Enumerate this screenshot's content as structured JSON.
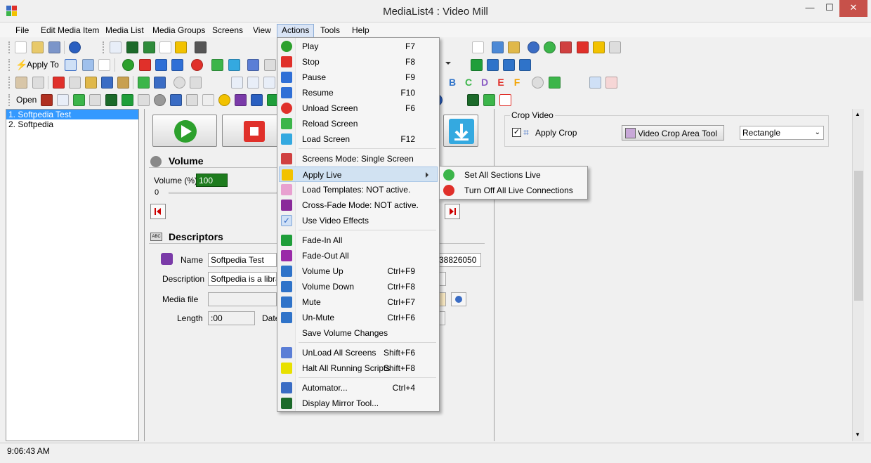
{
  "window": {
    "title": "MediaList4 : Video Mill"
  },
  "menubar": [
    "File",
    "Edit Media Item",
    "Media List",
    "Media Groups",
    "Screens",
    "View",
    "Actions",
    "Tools",
    "Help"
  ],
  "toolbar": {
    "apply_to": "Apply To",
    "open": "Open"
  },
  "media_list": [
    "1. Softpedia Test",
    "2. Softpedia"
  ],
  "volume": {
    "header": "Volume",
    "label": "Volume (%)",
    "value": "100",
    "min": "0"
  },
  "descriptors": {
    "header": "Descriptors",
    "name_label": "Name",
    "name_value": "Softpedia Test",
    "description_label": "Description",
    "description_value": "Softpedia is a library",
    "media_file_label": "Media file",
    "length_label": "Length",
    "length_value": ":00",
    "date_label": "Date",
    "id_value": "38826050"
  },
  "crop": {
    "group_title": "Crop Video",
    "apply_label": "Apply Crop",
    "tool_button": "Video Crop Area Tool",
    "shape_value": "Rectangle"
  },
  "letters": [
    "B",
    "C",
    "D",
    "E",
    "F"
  ],
  "status": {
    "time": "9:06:43 AM"
  },
  "actions_menu": {
    "items": [
      {
        "label": "Play",
        "shortcut": "F7",
        "icon": "play-icon",
        "color": "#2ca02c"
      },
      {
        "label": "Stop",
        "shortcut": "F8",
        "icon": "stop-icon",
        "color": "#e0302a"
      },
      {
        "label": "Pause",
        "shortcut": "F9",
        "icon": "pause-icon",
        "color": "#2f6fd6"
      },
      {
        "label": "Resume",
        "shortcut": "F10",
        "icon": "resume-icon",
        "color": "#2f6fd6"
      },
      {
        "label": "Unload Screen",
        "shortcut": "F6",
        "icon": "unload-screen-icon",
        "color": "#e0302a"
      },
      {
        "label": "Reload Screen",
        "shortcut": "",
        "icon": "reload-screen-icon",
        "color": "#3cb54a"
      },
      {
        "label": "Load Screen",
        "shortcut": "F12",
        "icon": "load-screen-icon",
        "color": "#34a9e0"
      },
      {
        "label": "Screens Mode: Single Screen",
        "shortcut": "",
        "icon": "screens-mode-icon",
        "color": "#d04040"
      },
      {
        "label": "Apply Live",
        "shortcut": "",
        "icon": "lightning-icon",
        "color": "#f2c200"
      },
      {
        "label": "Load Templates: NOT active.",
        "shortcut": "",
        "icon": "templates-icon",
        "color": "#e8a0d0"
      },
      {
        "label": "Cross-Fade Mode: NOT active.",
        "shortcut": "",
        "icon": "cross-fade-icon",
        "color": "#8a2a9a"
      },
      {
        "label": "Use Video Effects",
        "shortcut": "",
        "icon": "check-icon",
        "color": "#2d66c4"
      },
      {
        "label": "Fade-In All",
        "shortcut": "",
        "icon": "fade-in-icon",
        "color": "#1f9e3a"
      },
      {
        "label": "Fade-Out All",
        "shortcut": "",
        "icon": "fade-out-icon",
        "color": "#9a2aa8"
      },
      {
        "label": "Volume Up",
        "shortcut": "Ctrl+F9",
        "icon": "volume-up-icon",
        "color": "#2f73c9"
      },
      {
        "label": "Volume Down",
        "shortcut": "Ctrl+F8",
        "icon": "volume-down-icon",
        "color": "#2f73c9"
      },
      {
        "label": "Mute",
        "shortcut": "Ctrl+F7",
        "icon": "mute-icon",
        "color": "#2f73c9"
      },
      {
        "label": "Un-Mute",
        "shortcut": "Ctrl+F6",
        "icon": "unmute-icon",
        "color": "#2f73c9"
      },
      {
        "label": "Save Volume Changes",
        "shortcut": "",
        "icon": "",
        "color": ""
      },
      {
        "label": "UnLoad All Screens",
        "shortcut": "Shift+F6",
        "icon": "unload-all-icon",
        "color": "#5b7ed6"
      },
      {
        "label": "Halt All Running Scripts",
        "shortcut": "Shift+F8",
        "icon": "halt-icon",
        "color": "#e8e000"
      },
      {
        "label": "Automator...",
        "shortcut": "Ctrl+4",
        "icon": "automator-icon",
        "color": "#3a6cc4"
      },
      {
        "label": "Display Mirror Tool...",
        "shortcut": "",
        "icon": "mirror-tool-icon",
        "color": "#1c6a2a"
      }
    ]
  },
  "apply_live_submenu": [
    {
      "label": "Set All Sections Live",
      "icon": "power-on-icon",
      "color": "#3cb54a"
    },
    {
      "label": "Turn Off All Live Connections",
      "icon": "power-off-icon",
      "color": "#e0302a"
    }
  ],
  "colors": {
    "accent": "#3399ff",
    "menu_highlight": "#d1e2f2",
    "volume_box": "#1e7c1e"
  }
}
